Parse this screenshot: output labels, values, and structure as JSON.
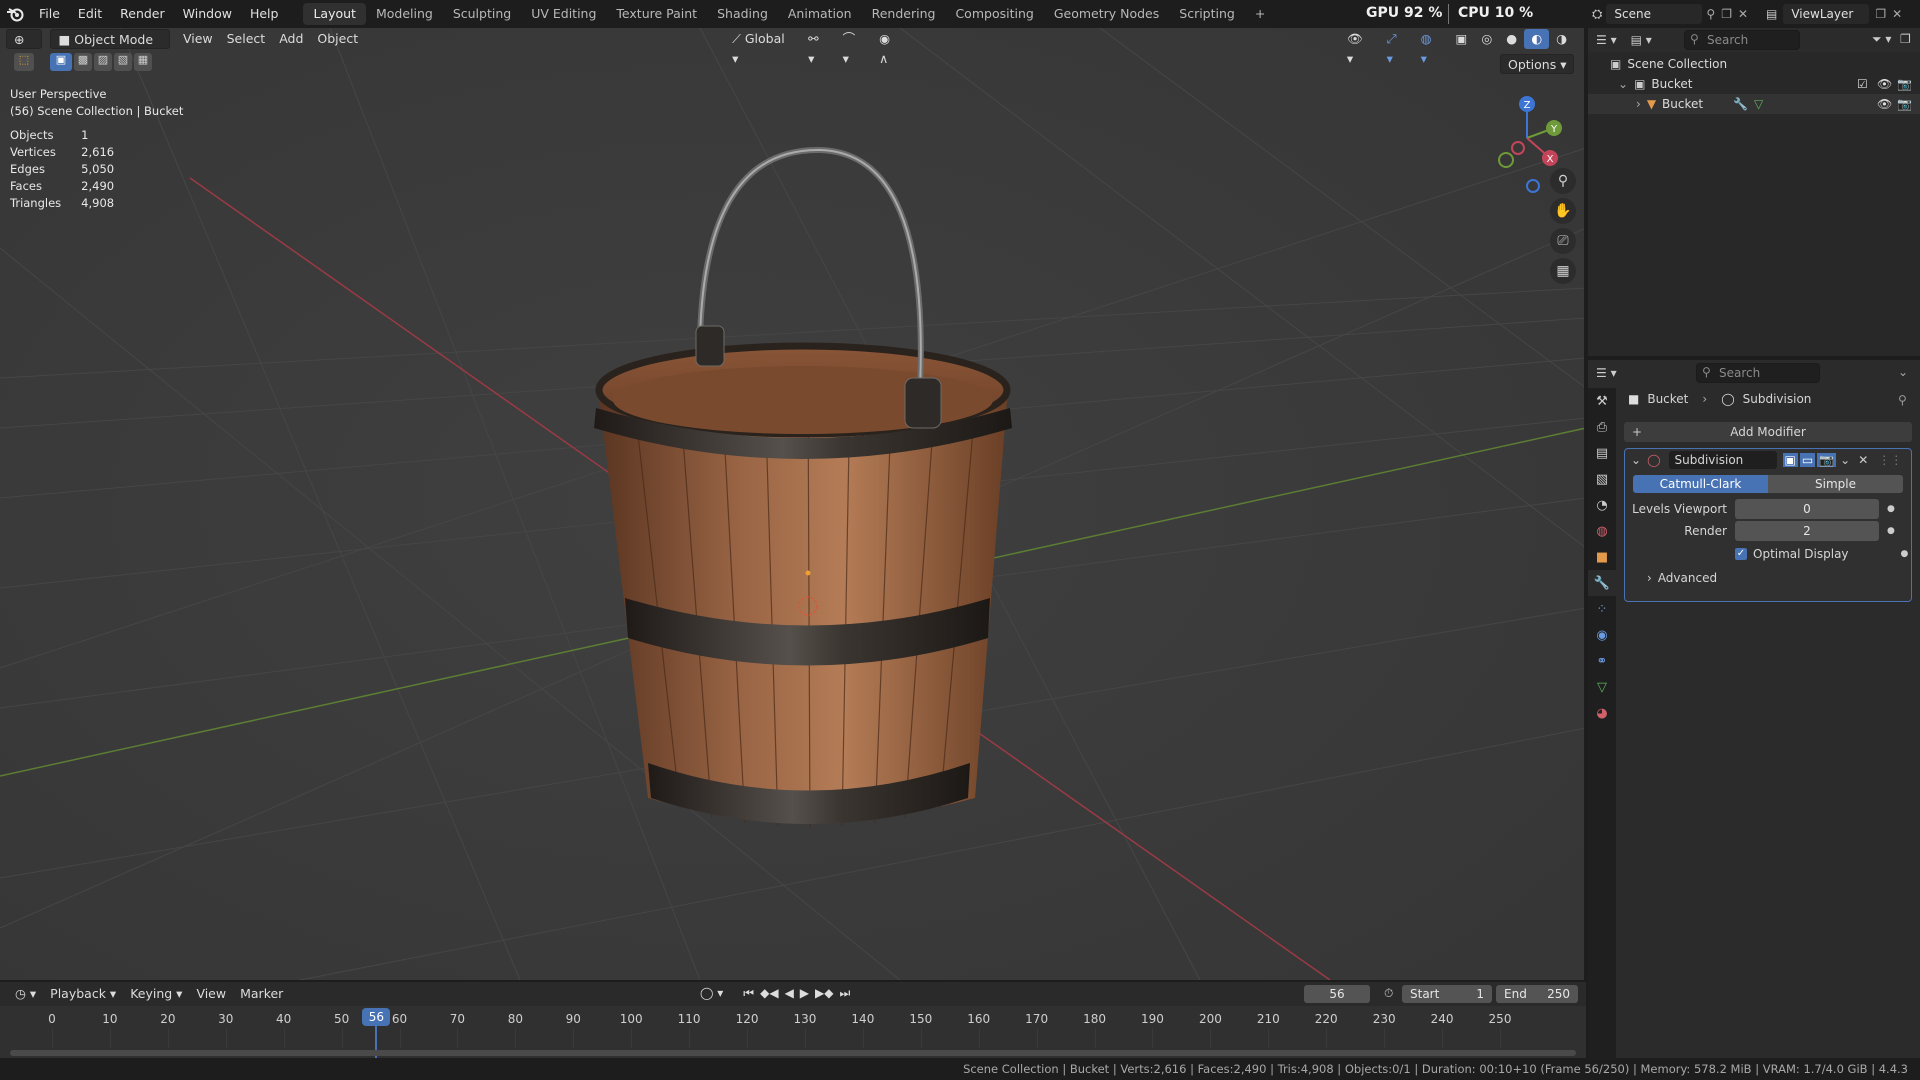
{
  "menu": [
    "File",
    "Edit",
    "Render",
    "Window",
    "Help"
  ],
  "workspaces": [
    "Layout",
    "Modeling",
    "Sculpting",
    "UV Editing",
    "Texture Paint",
    "Shading",
    "Animation",
    "Rendering",
    "Compositing",
    "Geometry Nodes",
    "Scripting"
  ],
  "active_workspace": "Layout",
  "add_workspace": "+",
  "gpu_label": "GPU",
  "gpu_value": "92 %",
  "cpu_label": "CPU",
  "cpu_value": "10 %",
  "scene": "Scene",
  "view_layer": "ViewLayer",
  "viewport": {
    "mode": "Object Mode",
    "menus": [
      "View",
      "Select",
      "Add",
      "Object"
    ],
    "transform_orientation": "Global",
    "options": "Options",
    "perspective": "User Perspective",
    "context": "(56) Scene Collection | Bucket",
    "stats": [
      {
        "label": "Objects",
        "value": "1"
      },
      {
        "label": "Vertices",
        "value": "2,616"
      },
      {
        "label": "Edges",
        "value": "5,050"
      },
      {
        "label": "Faces",
        "value": "2,490"
      },
      {
        "label": "Triangles",
        "value": "4,908"
      }
    ],
    "gizmo": {
      "x": "X",
      "y": "Y",
      "z": "Z"
    }
  },
  "timeline": {
    "menus": [
      "Playback",
      "Keying",
      "View",
      "Marker"
    ],
    "current_frame": "56",
    "start_label": "Start",
    "start": "1",
    "end_label": "End",
    "end": "250",
    "ticks": [
      "0",
      "10",
      "20",
      "30",
      "40",
      "50",
      "60",
      "70",
      "80",
      "90",
      "100",
      "110",
      "120",
      "130",
      "140",
      "150",
      "160",
      "170",
      "180",
      "190",
      "200",
      "210",
      "220",
      "230",
      "240",
      "250"
    ]
  },
  "outliner": {
    "search_placeholder": "Search",
    "root": "Scene Collection",
    "collection": "Bucket",
    "object": "Bucket"
  },
  "properties": {
    "search_placeholder": "Search",
    "breadcrumb_object": "Bucket",
    "breadcrumb_modifier": "Subdivision",
    "add_modifier": "Add Modifier",
    "modifier_name": "Subdivision",
    "type_options": [
      "Catmull-Clark",
      "Simple"
    ],
    "active_type": "Catmull-Clark",
    "levels_viewport_label": "Levels Viewport",
    "levels_viewport": "0",
    "render_label": "Render",
    "render_levels": "2",
    "optimal_display_label": "Optimal Display",
    "optimal_display": true,
    "advanced_label": "Advanced"
  },
  "status_bar": "Scene Collection | Bucket | Verts:2,616 | Faces:2,490 | Tris:4,908 | Objects:0/1 | Duration: 00:10+10 (Frame 56/250) | Memory: 578.2 MiB | VRAM: 1.7/4.0 GiB | 4.4.3",
  "colors": {
    "accent": "#4772b3",
    "x_axis": "#c4455a",
    "y_axis": "#6e9a3a",
    "z_axis": "#3d75d4",
    "playhead": "#4772b3"
  }
}
